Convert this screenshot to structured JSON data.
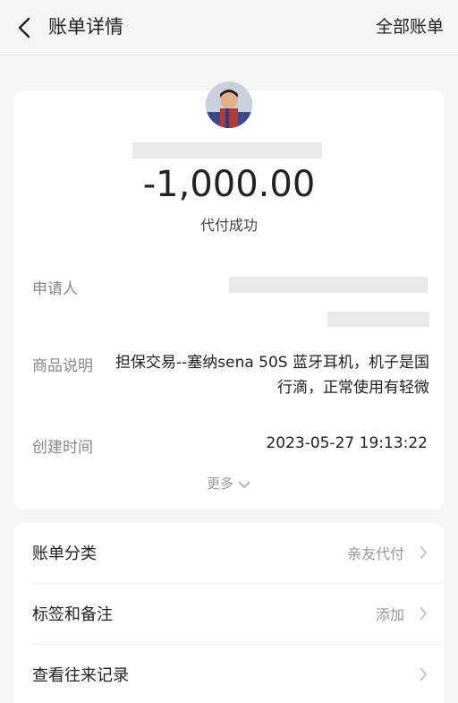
{
  "header": {
    "title": "账单详情",
    "right_link": "全部账单",
    "back_icon": "back-arrow-icon"
  },
  "summary": {
    "amount": "-1,000.00",
    "status": "代付成功"
  },
  "details": {
    "applicant_label": "申请人",
    "description_label": "商品说明",
    "description_value": "担保交易--塞纳sena 50S 蓝牙耳机，机子是国行滴，正常使用有轻微",
    "created_label": "创建时间",
    "created_value": "2023-05-27 19:13:22",
    "more_label": "更多"
  },
  "actions": [
    {
      "label": "账单分类",
      "value": "亲友代付"
    },
    {
      "label": "标签和备注",
      "value": "添加"
    },
    {
      "label": "查看往来记录",
      "value": ""
    }
  ],
  "colors": {
    "background": "#f5f5f5",
    "card": "#ffffff",
    "text_primary": "#222222",
    "text_secondary": "#888888",
    "redaction": "#e8e8e8"
  }
}
